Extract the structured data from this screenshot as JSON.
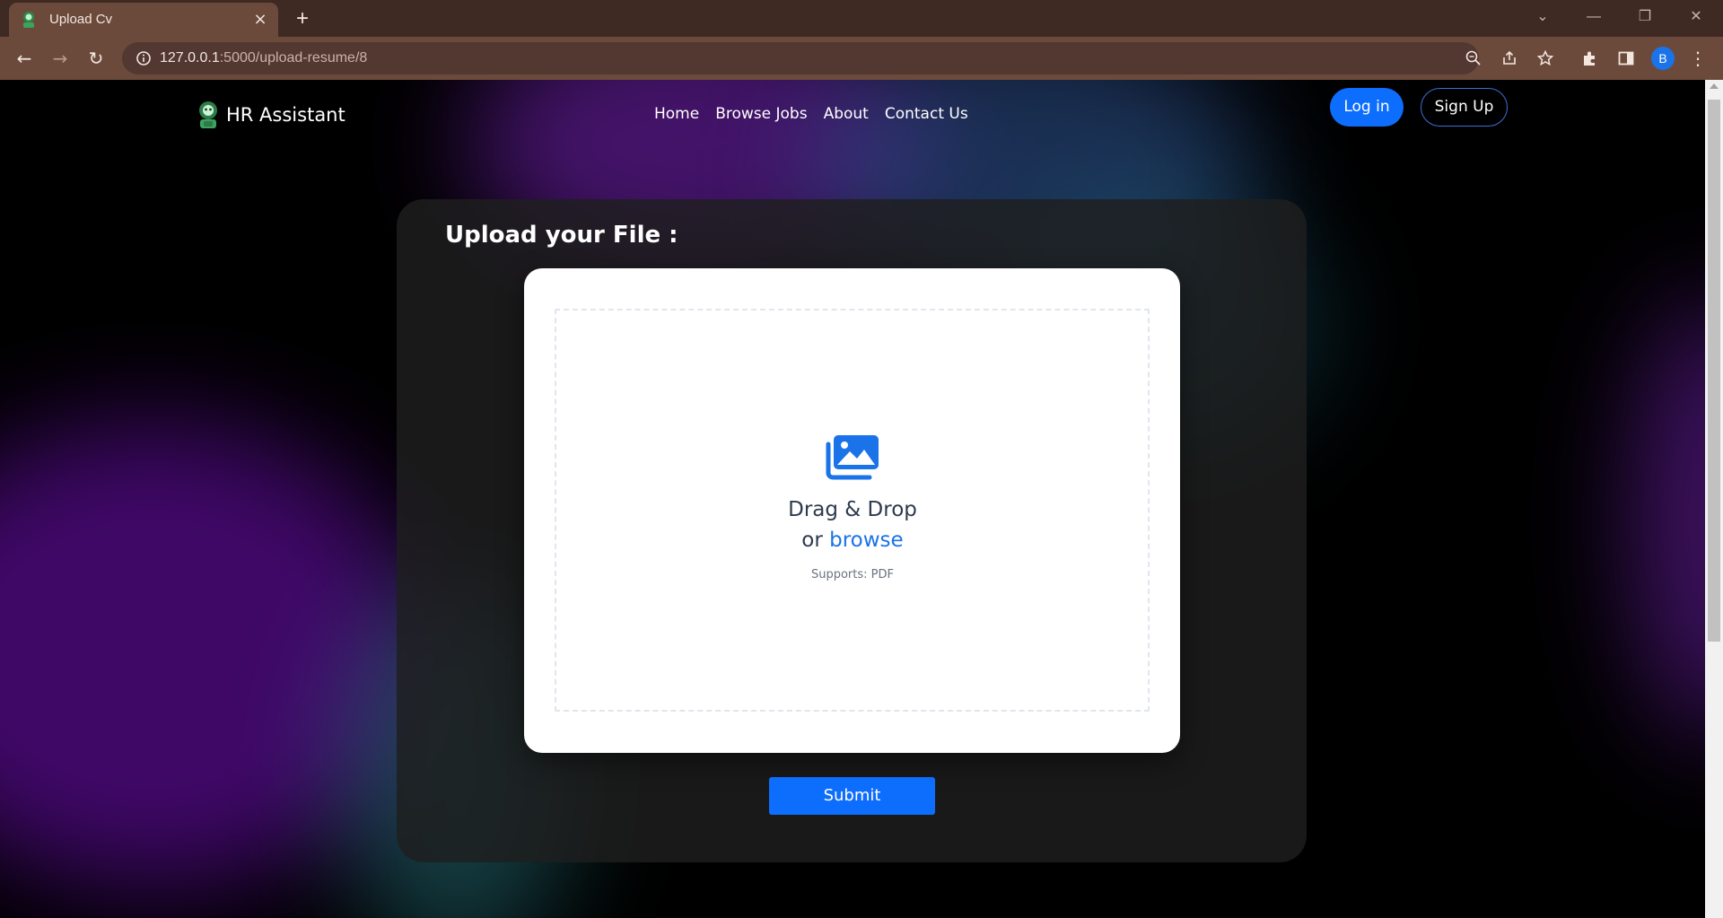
{
  "browser": {
    "tab_title": "Upload Cv",
    "tab_close": "×",
    "new_tab": "+",
    "url_host": "127.0.0.1",
    "url_rest": ":5000/upload-resume/8",
    "profile_initial": "B",
    "controls": {
      "tab_search": "⌄",
      "minimize": "—",
      "restore": "❐",
      "close": "✕"
    },
    "nav_glyphs": {
      "back": "←",
      "forward": "→",
      "reload": "↻",
      "menu": "⋮"
    }
  },
  "navbar": {
    "brand": "HR Assistant",
    "links": [
      "Home",
      "Browse Jobs",
      "About",
      "Contact Us"
    ],
    "login_label": "Log in",
    "signup_label": "Sign Up"
  },
  "upload": {
    "title": "Upload your File :",
    "drag_text": "Drag & Drop",
    "or_text": "or",
    "browse_text": "browse",
    "supports_text": "Supports: PDF",
    "submit_label": "Submit"
  },
  "colors": {
    "accent": "#0d6efd",
    "link": "#1a73e8",
    "chrome_dark": "#3e2a23",
    "chrome": "#6b4a3c"
  },
  "icons": [
    "info-icon",
    "zoom-icon",
    "share-icon",
    "star-icon",
    "extensions-icon",
    "side-panel-icon",
    "gallery-icon",
    "robot-logo-icon"
  ]
}
